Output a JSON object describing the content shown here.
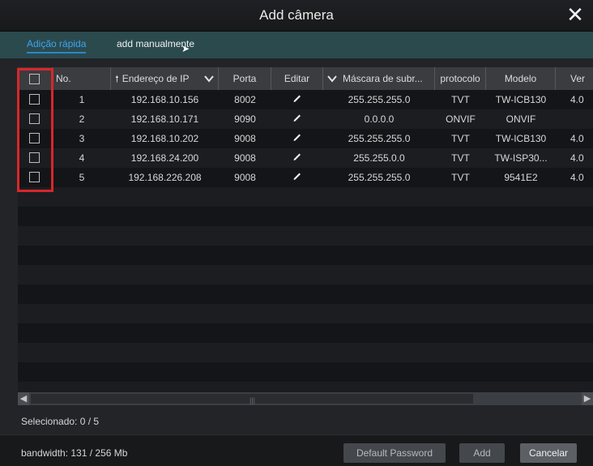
{
  "window": {
    "title": "Add câmera",
    "close_icon": "close-icon"
  },
  "tabs": [
    {
      "label": "Adição rápida",
      "active": true
    },
    {
      "label": "add manualmente",
      "active": false
    }
  ],
  "table": {
    "columns": [
      "No.",
      "Endereço de IP",
      "Porta",
      "Editar",
      "Máscara de subr...",
      "protocolo",
      "Modelo",
      "Ver"
    ],
    "rows": [
      {
        "no": "1",
        "ip": "192.168.10.156",
        "port": "8002",
        "mask": "255.255.255.0",
        "protocol": "TVT",
        "model": "TW-ICB130",
        "ver": "4.0"
      },
      {
        "no": "2",
        "ip": "192.168.10.171",
        "port": "9090",
        "mask": "0.0.0.0",
        "protocol": "ONVIF",
        "model": "ONVIF",
        "ver": ""
      },
      {
        "no": "3",
        "ip": "192.168.10.202",
        "port": "9008",
        "mask": "255.255.255.0",
        "protocol": "TVT",
        "model": "TW-ICB130",
        "ver": "4.0"
      },
      {
        "no": "4",
        "ip": "192.168.24.200",
        "port": "9008",
        "mask": "255.255.0.0",
        "protocol": "TVT",
        "model": "TW-ISP30...",
        "ver": "4.0"
      },
      {
        "no": "5",
        "ip": "192.168.226.208",
        "port": "9008",
        "mask": "255.255.255.0",
        "protocol": "TVT",
        "model": "9541E2",
        "ver": "4.0"
      }
    ]
  },
  "status": {
    "selected": "Selecionado: 0 / 5",
    "bandwidth": "bandwidth: 131 / 256 Mb"
  },
  "buttons": {
    "default_password": "Default Password",
    "add": "Add",
    "cancel": "Cancelar"
  },
  "colors": {
    "highlight": "#d9262b",
    "tab_active": "#3aa5f0",
    "tabs_bg": "#2b4a4e"
  }
}
